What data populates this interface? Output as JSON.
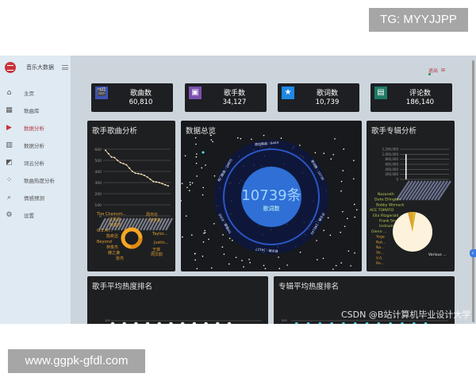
{
  "watermarks": {
    "top": "TG: MYYJJPP",
    "bottom": "www.ggpk-gfdl.com",
    "csdn": "CSDN @B站计算机毕业设计大学"
  },
  "app": {
    "title": "音乐大数据",
    "logout": "退出"
  },
  "sidebar": {
    "items": [
      {
        "label": "主页",
        "icon": "home-icon"
      },
      {
        "label": "歌曲库",
        "icon": "grid-icon"
      },
      {
        "label": "数据分析",
        "icon": "play-circle-icon",
        "active": true
      },
      {
        "label": "数据分析",
        "icon": "bar-chart-icon"
      },
      {
        "label": "词云分析",
        "icon": "cloud-doc-icon"
      },
      {
        "label": "歌曲热度分析",
        "icon": "scatter-icon"
      },
      {
        "label": "情感预测",
        "icon": "search-doc-icon"
      },
      {
        "label": "设置",
        "icon": "gear-icon"
      }
    ]
  },
  "colors": {
    "active": "#c8323c",
    "panel": "#1e1f21",
    "accent_blue": "#2f6fd6",
    "line": "#f0c070",
    "donut": "#f5a623",
    "bar2": "#4fd1e8"
  },
  "stats": [
    {
      "label": "歌曲数",
      "value": "60,810",
      "icon": "clapperboard-icon",
      "color": "#3f51b5"
    },
    {
      "label": "歌手数",
      "value": "34,127",
      "icon": "video-folder-icon",
      "color": "#7b4fb0"
    },
    {
      "label": "歌词数",
      "value": "10,739",
      "icon": "star-icon",
      "color": "#1e88e5"
    },
    {
      "label": "评论数",
      "value": "186,140",
      "icon": "contact-folder-icon",
      "color": "#1f7a66"
    }
  ],
  "panels": {
    "singer_song": "歌手歌曲分析",
    "overview": "数据总览",
    "singer_album": "歌手专辑分析",
    "singer_heat": "歌手平均热度排名",
    "album_heat": "专辑平均热度排名"
  },
  "overview": {
    "center_value": "10739条",
    "center_label": "歌词数",
    "ring_labels": [
      "原创歌曲 : 6443",
      "歌词数 : 10739",
      "评论数 : 186140",
      "歌手数 : 34127",
      "T/P歌曲 : 6350",
      "热门歌曲 : 28805"
    ]
  },
  "chart_data": [
    {
      "type": "line",
      "ylim": [
        0,
        600
      ],
      "yticks": [
        0,
        100,
        200,
        300,
        400,
        500,
        600
      ],
      "grid": true,
      "values": [
        590,
        560,
        530,
        525,
        500,
        480,
        470,
        460,
        430,
        400,
        385,
        380,
        375,
        365,
        350,
        330,
        310,
        305,
        300,
        290,
        280,
        270
      ]
    },
    {
      "type": "pie",
      "donut": true,
      "labels_left": [
        "The Chainsm...",
        "汪苏泷",
        "林俊杰",
        "G.E.M...",
        "陈奕迅",
        "Beyond",
        "林俊杰",
        "薛之谦",
        "张杰"
      ],
      "labels_right": [
        "周杰伦",
        "张学友",
        "Taylor...",
        "Justin...",
        "王菲",
        "周文韵"
      ]
    },
    {
      "type": "bar",
      "ylim": [
        0,
        1200000
      ],
      "yticks": [
        "0",
        "200,000",
        "400,000",
        "600,000",
        "800,000",
        "1,000,000",
        "1,200,000"
      ],
      "grid": true,
      "values": [
        1000000
      ]
    },
    {
      "type": "pie",
      "labels": [
        "Nazareth",
        "Duke Ellington",
        "Bobby Womack",
        "ACE TOMATO",
        "Ella Fitzgerald",
        "Frank Sinatra",
        "Instrumental",
        "Glenn ...",
        "Yoga",
        "Nat...",
        "Na...",
        "Vo...",
        "V.A.",
        "Re...",
        "Various ..."
      ],
      "values": [
        94,
        1,
        1,
        1,
        1,
        1,
        1
      ]
    },
    {
      "type": "scatter",
      "ytick": "100"
    },
    {
      "type": "bar",
      "ytick": "500"
    }
  ]
}
